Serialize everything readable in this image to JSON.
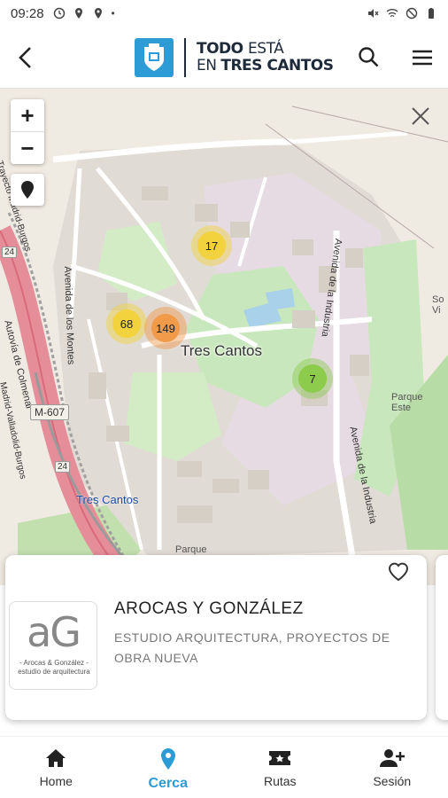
{
  "status_bar": {
    "time": "09:28",
    "left_icons": [
      "alarm-icon",
      "location-icon",
      "location-icon",
      "dot-icon"
    ],
    "right_icons": [
      "mute-icon",
      "wifi-icon",
      "dnd-icon",
      "battery-icon"
    ]
  },
  "header": {
    "logo_line1_bold": "TODO",
    "logo_line1_light": "ESTÁ",
    "logo_line2_light": "EN",
    "logo_line2_bold": "TRES CANTOS"
  },
  "map": {
    "zoom_in": "+",
    "zoom_out": "−",
    "city_label": "Tres Cantos",
    "station_label": "Tres Cantos",
    "road_badge_1": "M-607",
    "road_badge_2": "24",
    "road_badge_3": "24",
    "area_label_1": "Parque\nEste",
    "area_label_2": "Parque",
    "area_label_3": "So\nVi",
    "streets": {
      "s1": "Autovía de Colmenar",
      "s2": "Avenida de los Montes",
      "s3": "Avenida de la Industria",
      "s4": "Avenida de la Industria",
      "s5": "Trayecto Madrid-Burgos",
      "s6": "Madrid-Valladolid-Burgos"
    },
    "clusters": [
      {
        "count": "17",
        "color": "#f2d33d",
        "ring": "rgba(240,210,60,0.45)"
      },
      {
        "count": "68",
        "color": "#f2d33d",
        "ring": "rgba(240,210,60,0.45)"
      },
      {
        "count": "149",
        "color": "#f09a4a",
        "ring": "rgba(240,150,70,0.45)"
      },
      {
        "count": "7",
        "color": "#8ccb4c",
        "ring": "rgba(140,200,80,0.45)"
      }
    ]
  },
  "card": {
    "title": "AROCAS Y GONZÁLEZ",
    "description": "ESTUDIO ARQUITECTURA, PROYECTOS DE OBRA NUEVA",
    "thumb_caption_1": "- Arocas & González -",
    "thumb_caption_2": "estudio de arquitectura",
    "thumb_logo_text": "aG"
  },
  "bottom_nav": {
    "items": [
      {
        "label": "Home",
        "icon": "home-icon"
      },
      {
        "label": "Cerca",
        "icon": "location-pin-icon"
      },
      {
        "label": "Rutas",
        "icon": "ticket-icon"
      },
      {
        "label": "Sesión",
        "icon": "add-user-icon"
      }
    ],
    "active": "Cerca",
    "accent": "#2d9bd6"
  }
}
